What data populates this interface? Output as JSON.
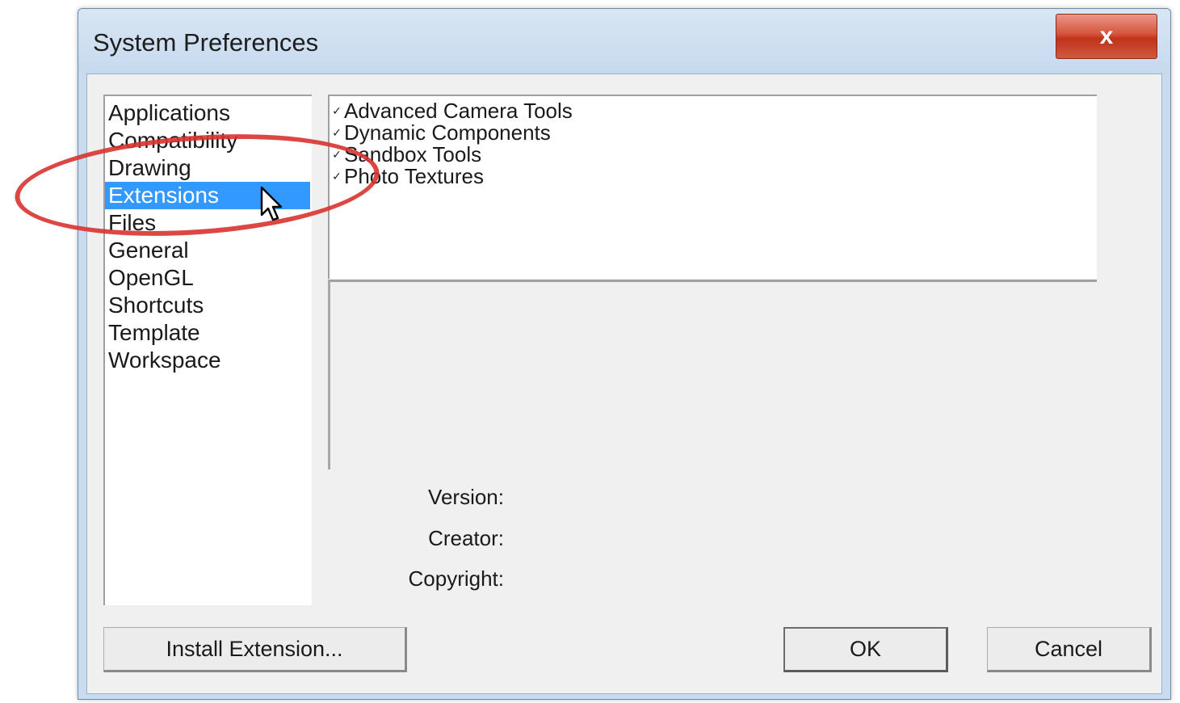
{
  "window": {
    "title": "System Preferences",
    "close_label": "x"
  },
  "categories": [
    {
      "label": "Applications",
      "selected": false
    },
    {
      "label": "Compatibility",
      "selected": false
    },
    {
      "label": "Drawing",
      "selected": false
    },
    {
      "label": "Extensions",
      "selected": true
    },
    {
      "label": "Files",
      "selected": false
    },
    {
      "label": "General",
      "selected": false
    },
    {
      "label": "OpenGL",
      "selected": false
    },
    {
      "label": "Shortcuts",
      "selected": false
    },
    {
      "label": "Template",
      "selected": false
    },
    {
      "label": "Workspace",
      "selected": false
    }
  ],
  "extensions": [
    {
      "label": "Advanced Camera Tools",
      "checked": true
    },
    {
      "label": "Dynamic Components",
      "checked": true
    },
    {
      "label": "Sandbox Tools",
      "checked": true
    },
    {
      "label": "Photo Textures",
      "checked": true
    }
  ],
  "details": {
    "version_label": "Version:",
    "creator_label": "Creator:",
    "copyright_label": "Copyright:"
  },
  "buttons": {
    "install_label": "Install Extension...",
    "ok_label": "OK",
    "cancel_label": "Cancel"
  },
  "colors": {
    "selection": "#3399ff",
    "highlight_annotation": "#d8332f",
    "close_button": "#c7432a"
  }
}
